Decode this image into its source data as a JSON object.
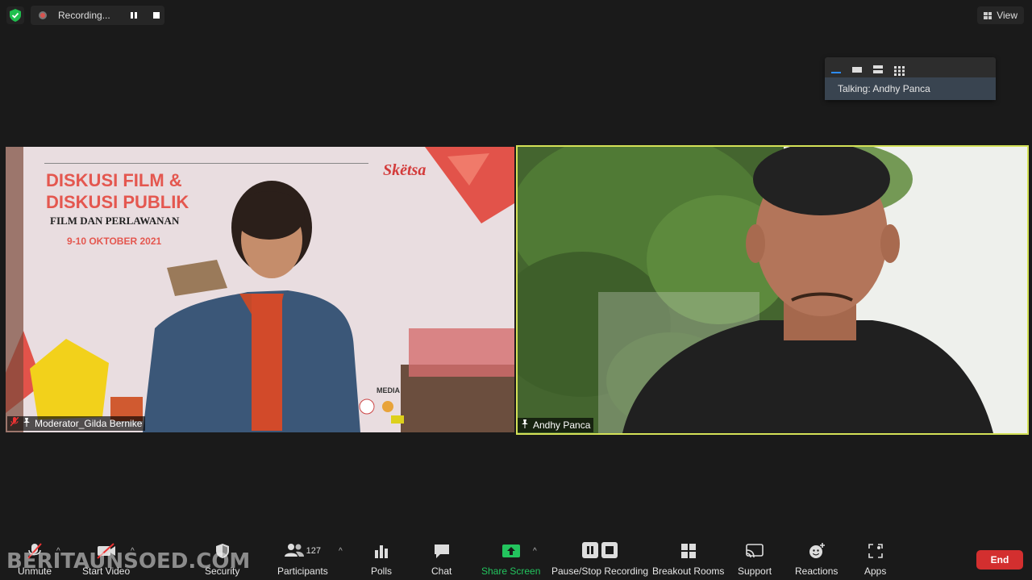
{
  "top_bar": {
    "recording_label": "Recording...",
    "view_label": "View"
  },
  "layout_popup": {
    "talking_text": "Talking: Andhy Panca"
  },
  "tiles": {
    "left": {
      "name": "Moderator_Gilda Bernike",
      "slide": {
        "title_line1": "DISKUSI FILM &",
        "title_line2": "DISKUSI PUBLIK",
        "subtitle": "FILM DAN PERLAWANAN",
        "date": "9-10 OKTOBER 2021",
        "brand": "Skëtsa",
        "media_label": "MEDIA"
      }
    },
    "right": {
      "name": "Andhy Panca"
    }
  },
  "toolbar": {
    "unmute": "Unmute",
    "start_video": "Start Video",
    "security": "Security",
    "participants": "Participants",
    "participants_count": "127",
    "polls": "Polls",
    "chat": "Chat",
    "share_screen": "Share Screen",
    "pause_stop": "Pause/Stop Recording",
    "breakout": "Breakout Rooms",
    "support": "Support",
    "reactions": "Reactions",
    "apps": "Apps",
    "end": "End"
  },
  "watermark": "BERITAUNSOED.COM",
  "colors": {
    "active_speaker_border": "#d4e157",
    "share_screen_green": "#23c45e",
    "end_red": "#d32f2f",
    "recording_red": "#d9534f"
  }
}
